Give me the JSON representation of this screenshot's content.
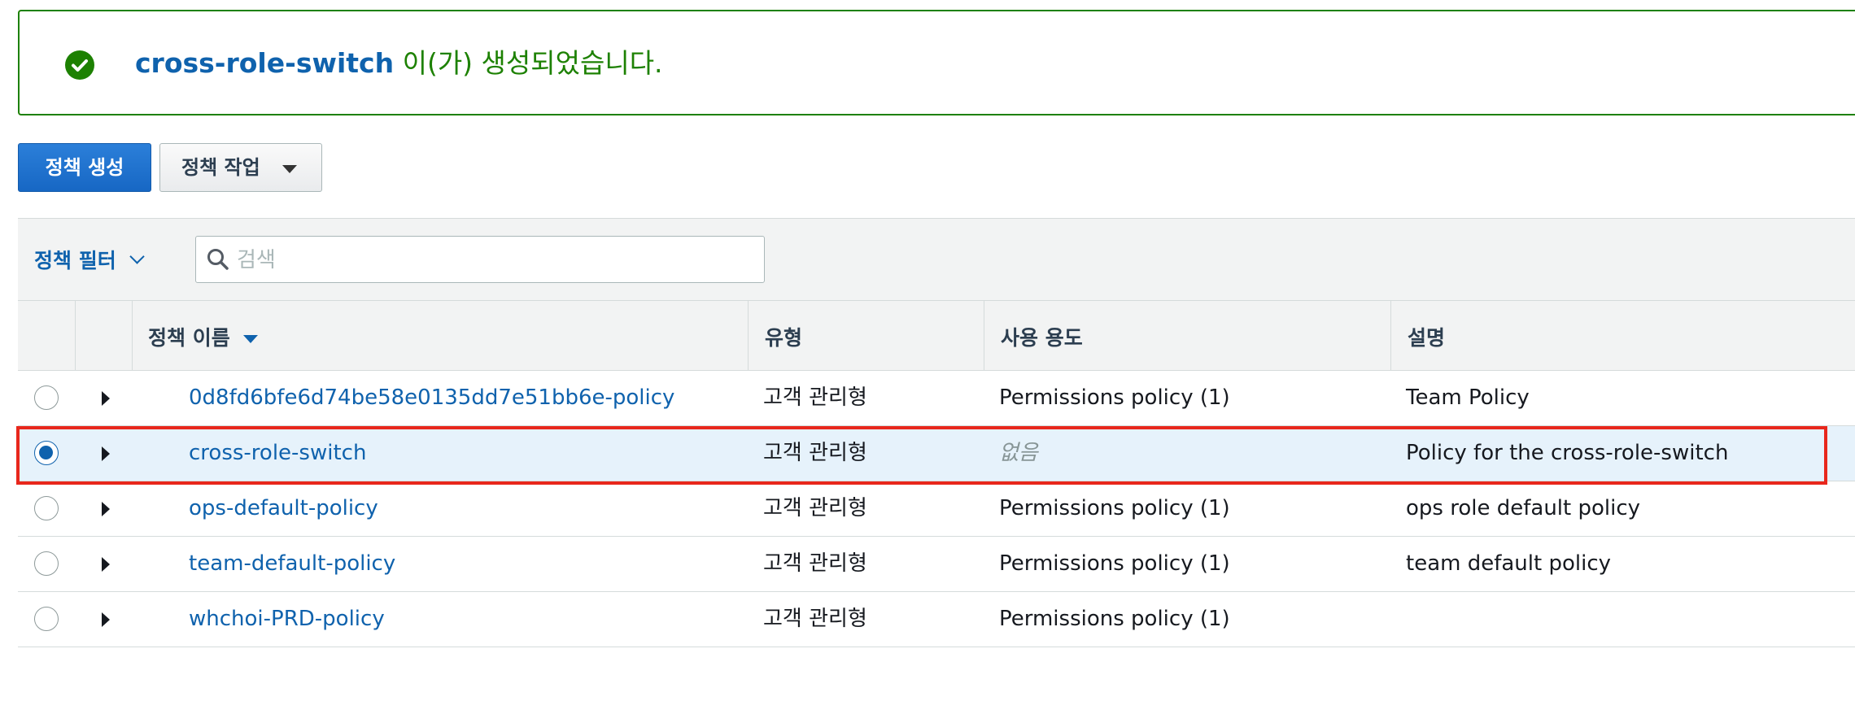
{
  "flash": {
    "policy_name": "cross-role-switch",
    "message": " 이(가) 생성되었습니다.",
    "icon": "check-circle-icon",
    "color": "#1d8102"
  },
  "toolbar": {
    "create_label": "정책 생성",
    "actions_label": "정책 작업"
  },
  "filter": {
    "label": "정책 필터",
    "search_placeholder": "검색"
  },
  "table": {
    "headers": {
      "name": "정책 이름",
      "type": "유형",
      "usage": "사용 용도",
      "description": "설명"
    },
    "rows": [
      {
        "name": "0d8fd6bfe6d74be58e0135dd7e51bb6e-policy",
        "type": "고객 관리형",
        "usage": "Permissions policy (1)",
        "description": "Team Policy",
        "selected": false
      },
      {
        "name": "cross-role-switch",
        "type": "고객 관리형",
        "usage": "없음",
        "description": "Policy for the cross-role-switch",
        "selected": true
      },
      {
        "name": "ops-default-policy",
        "type": "고객 관리형",
        "usage": "Permissions policy (1)",
        "description": "ops role default policy",
        "selected": false
      },
      {
        "name": "team-default-policy",
        "type": "고객 관리형",
        "usage": "Permissions policy (1)",
        "description": "team default policy",
        "selected": false
      },
      {
        "name": "whchoi-PRD-policy",
        "type": "고객 관리형",
        "usage": "Permissions policy (1)",
        "description": "",
        "selected": false
      }
    ]
  },
  "colors": {
    "link": "#0f62ad",
    "primary": "#1767c4",
    "selected_row": "#e6f2fb",
    "highlight": "#e8271c"
  }
}
